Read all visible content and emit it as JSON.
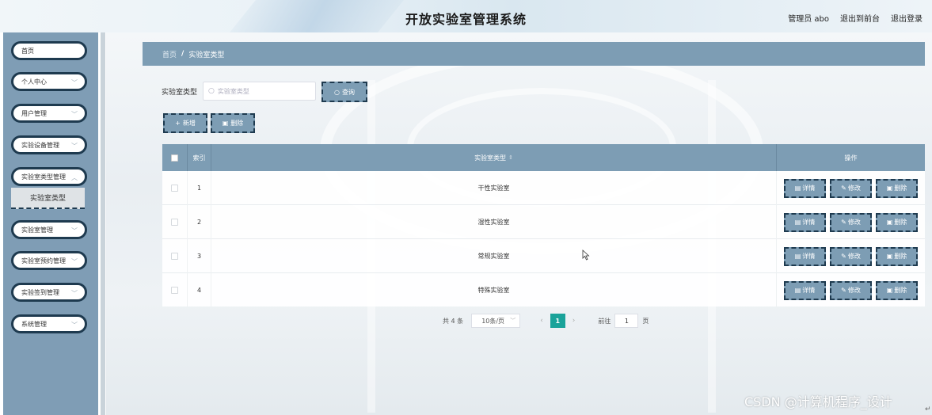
{
  "header": {
    "title": "开放实验室管理系统",
    "admin": "管理员 abo",
    "back_front": "退出到前台",
    "logout": "退出登录"
  },
  "sidebar": {
    "items": [
      {
        "label": "首页"
      },
      {
        "label": "个人中心"
      },
      {
        "label": "用户管理"
      },
      {
        "label": "实验设备管理"
      },
      {
        "label": "实验室类型管理"
      },
      {
        "label": "实验室管理"
      },
      {
        "label": "实验室预约管理"
      },
      {
        "label": "实验签到管理"
      },
      {
        "label": "系统管理"
      }
    ],
    "sub_item": "实验室类型"
  },
  "breadcrumb": {
    "home": "首页",
    "sep": "/",
    "current": "实验室类型"
  },
  "search": {
    "label": "实验室类型",
    "placeholder": "实验室类型",
    "query_button": "查询"
  },
  "actions": {
    "add": "新增",
    "delete": "删除"
  },
  "table": {
    "headers": {
      "index": "索引",
      "type": "实验室类型",
      "operation": "操作"
    },
    "rows": [
      {
        "index": "1",
        "type": "干性实验室"
      },
      {
        "index": "2",
        "type": "湿性实验室"
      },
      {
        "index": "3",
        "type": "常规实验室"
      },
      {
        "index": "4",
        "type": "特殊实验室"
      }
    ],
    "row_actions": {
      "detail": "详情",
      "edit": "修改",
      "delete": "删除"
    }
  },
  "pagination": {
    "total": "共 4 条",
    "page_size": "10条/页",
    "current_page": "1",
    "goto_label": "前往",
    "goto_value": "1",
    "page_unit": "页"
  },
  "watermark": "CSDN @计算机程序_设计",
  "colors": {
    "accent": "#7d9db4",
    "dark_border": "#1e3a4f",
    "active_page": "#1aa39a"
  }
}
